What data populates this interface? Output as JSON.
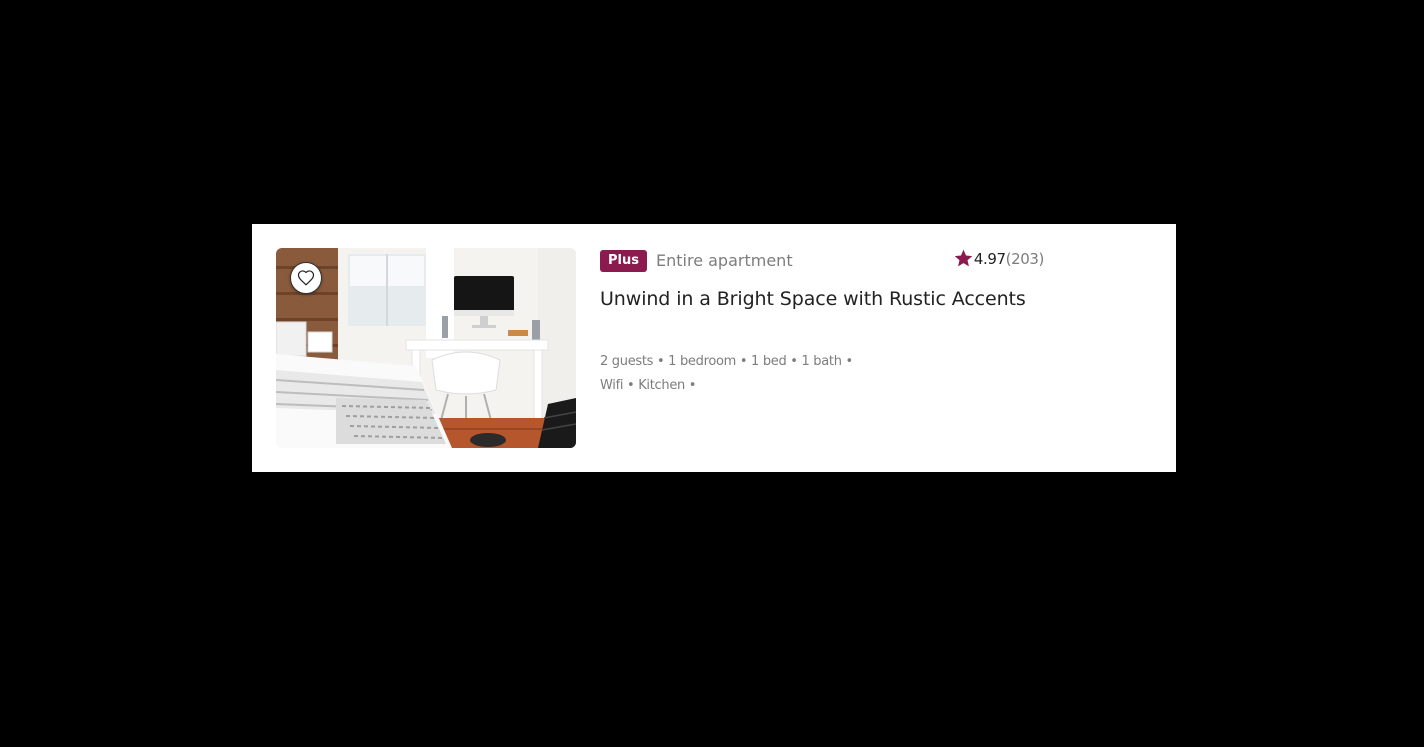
{
  "listing": {
    "badge": "Plus",
    "property_type": "Entire apartment",
    "rating_score": "4.97",
    "rating_count": "(203)",
    "title": "Unwind in a Bright Space with Rustic Accents",
    "details": "2 guests • 1 bedroom • 1 bed • 1 bath •",
    "amenities": "Wifi • Kitchen •"
  },
  "icons": {
    "favorite": "heart-icon",
    "rating": "star-icon"
  },
  "colors": {
    "accent": "#8b1a4e",
    "text_primary": "#222222",
    "text_secondary": "#7d7d7d",
    "background": "#000000",
    "card": "#ffffff"
  }
}
